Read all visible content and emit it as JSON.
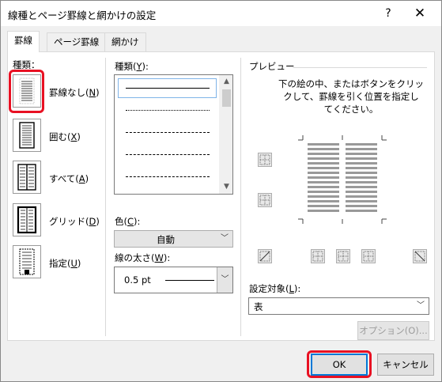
{
  "window": {
    "title": "線種とページ罫線と網かけの設定",
    "help_glyph": "?",
    "close_glyph": "✕"
  },
  "tabs": [
    {
      "label": "罫線",
      "active": true
    },
    {
      "label": "ページ罫線",
      "active": false
    },
    {
      "label": "網かけ",
      "active": false
    }
  ],
  "presets": {
    "heading": "種類：",
    "items": [
      {
        "label": "罫線なし(",
        "key": "N",
        "close": ")",
        "icon": "no-borders-icon",
        "highlighted": true
      },
      {
        "label": "囲む(",
        "key": "X",
        "close": ")",
        "icon": "box-border-icon"
      },
      {
        "label": "すべて(",
        "key": "A",
        "close": ")",
        "icon": "all-borders-icon"
      },
      {
        "label": "グリッド(",
        "key": "D",
        "close": ")",
        "icon": "grid-border-icon"
      },
      {
        "label": "指定(",
        "key": "U",
        "close": ")",
        "icon": "custom-border-icon"
      }
    ]
  },
  "style": {
    "label": "種類(",
    "key": "Y",
    "close": "):",
    "options": [
      "solid",
      "dotted",
      "dashed-small",
      "dashed",
      "dash-dot"
    ],
    "selected": "solid"
  },
  "color": {
    "label": "色(",
    "key": "C",
    "close": "):",
    "value": "自動"
  },
  "width": {
    "label": "線の太さ(",
    "key": "W",
    "close": "):",
    "value": "0.5 pt"
  },
  "preview": {
    "heading": "プレビュー",
    "instructions": [
      "下の絵の中、またはボタンをクリッ",
      "クして、罫線を引く位置を指定し",
      "てください。"
    ]
  },
  "apply_to": {
    "label": "設定対象(",
    "key": "L",
    "close": "):",
    "value": "表"
  },
  "buttons": {
    "options": "オプション(O)...",
    "ok": "OK",
    "cancel": "キャンセル"
  },
  "colors": {
    "highlight": "#e81123",
    "focus": "#0078d7"
  }
}
